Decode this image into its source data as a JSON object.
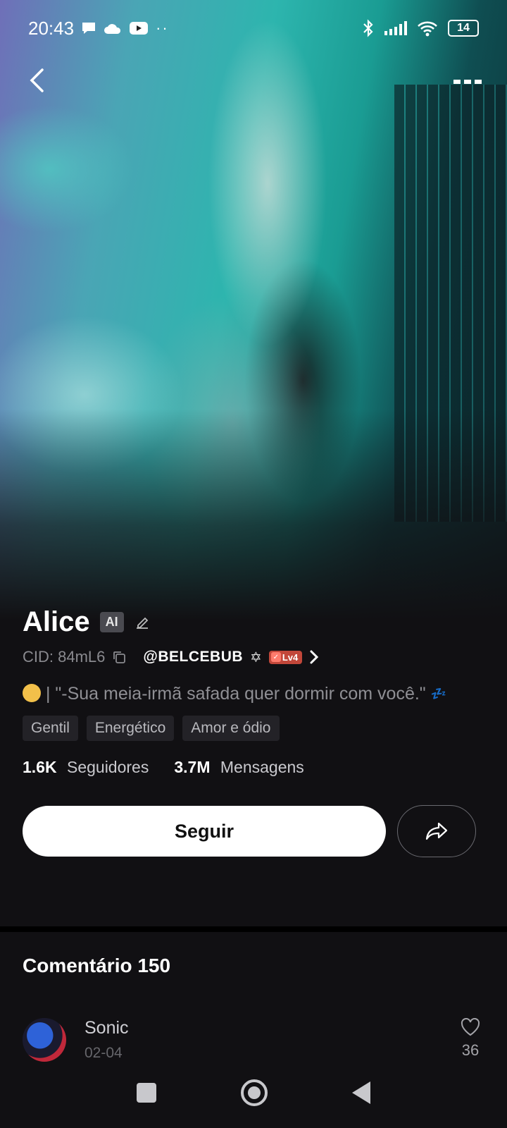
{
  "status_bar": {
    "time": "20:43",
    "battery": "14",
    "icons": [
      "chat-icon",
      "cloud-icon",
      "youtube-icon",
      "more-dots-icon",
      "bluetooth-icon",
      "signal-icon",
      "wifi-icon",
      "battery-icon"
    ]
  },
  "nav": {
    "back_icon": "chevron-left-icon",
    "more_icon": "more-icon"
  },
  "profile": {
    "name": "Alice",
    "ai_badge": "AI",
    "cid": "CID: 84mL6",
    "creator": "@BELCEBUB",
    "creator_symbol": "✡",
    "level": "Lv4",
    "bio_text": "| \"-Sua meia-irmã safada quer dormir com você.\"",
    "bio_emoji": "💤",
    "tags": [
      "Gentil",
      "Energético",
      "Amor e ódio"
    ],
    "followers_value": "1.6K",
    "followers_label": "Seguidores",
    "messages_value": "3.7M",
    "messages_label": "Mensagens",
    "follow_button": "Seguir"
  },
  "comments": {
    "title": "Comentário 150",
    "items": [
      {
        "user": "Sonic",
        "date": "02-04",
        "likes": "36"
      }
    ]
  },
  "colors": {
    "background": "#111013",
    "tag_bg": "#232227",
    "level_badge": "#c2473a",
    "follow_button_bg": "#ffffff"
  }
}
